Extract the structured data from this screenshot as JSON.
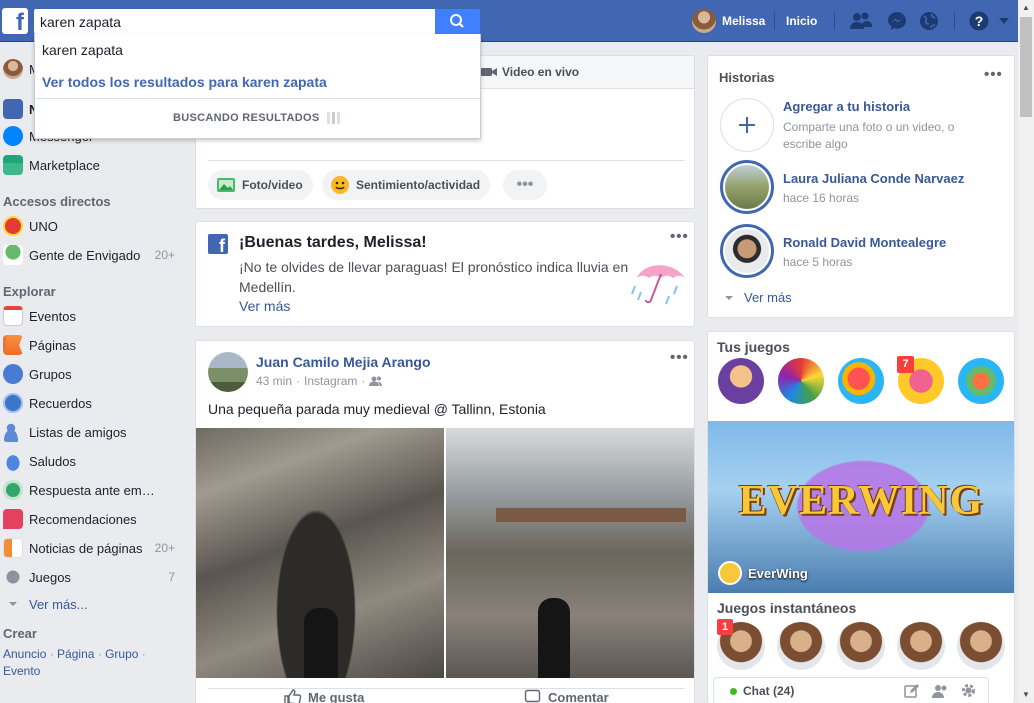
{
  "topbar": {
    "logo": "f",
    "search_value": "karen zapata",
    "user_name": "Melissa",
    "home_label": "Inicio",
    "icons": [
      "friend-requests-icon",
      "messenger-icon",
      "notifications-globe-icon",
      "help-icon",
      "caret-down-icon"
    ]
  },
  "dropdown": {
    "suggestion": "karen zapata",
    "see_all": "Ver todos los resultados para karen zapata",
    "status": "BUSCANDO RESULTADOS"
  },
  "left_nav": {
    "profile_initial": "M",
    "news_initial": "N",
    "messenger_partial": "Messenger",
    "marketplace": "Marketplace",
    "shortcuts_header": "Accesos directos",
    "shortcuts": [
      {
        "label": "UNO",
        "count": ""
      },
      {
        "label": "Gente de Envigado",
        "count": "20+"
      }
    ],
    "explore_header": "Explorar",
    "explore": [
      {
        "label": "Eventos",
        "count": ""
      },
      {
        "label": "Páginas",
        "count": ""
      },
      {
        "label": "Grupos",
        "count": ""
      },
      {
        "label": "Recuerdos",
        "count": ""
      },
      {
        "label": "Listas de amigos",
        "count": ""
      },
      {
        "label": "Saludos",
        "count": ""
      },
      {
        "label": "Respuesta ante em…",
        "count": ""
      },
      {
        "label": "Recomendaciones",
        "count": ""
      },
      {
        "label": "Noticias de páginas",
        "count": "20+"
      },
      {
        "label": "Juegos",
        "count": "7"
      }
    ],
    "see_more": "Ver más...",
    "create_header": "Crear",
    "create_links": [
      "Anuncio",
      "Página",
      "Grupo",
      "Evento"
    ]
  },
  "composer": {
    "live_video": "Video en vivo",
    "photo_video": "Foto/video",
    "feeling": "Sentimiento/actividad"
  },
  "weather": {
    "title": "¡Buenas tardes, Melissa!",
    "body": "¡No te olvides de llevar paraguas! El pronóstico indica lluvia en Medellín.",
    "more": "Ver más"
  },
  "post": {
    "author": "Juan Camilo Mejia Arango",
    "time": "43 min",
    "source": "Instagram",
    "text": "Una pequeña parada muy medieval @ Tallinn, Estonia",
    "like": "Me gusta",
    "comment": "Comentar"
  },
  "stories": {
    "header": "Historias",
    "add_title": "Agregar a tu historia",
    "add_sub": "Comparte una foto o un video, o escribe algo",
    "items": [
      {
        "name": "Laura Juliana Conde Narvaez",
        "time": "hace 16 horas"
      },
      {
        "name": "Ronald David Montealegre",
        "time": "hace 5 horas"
      }
    ],
    "see_more": "Ver más"
  },
  "games": {
    "header": "Tus juegos",
    "badge": "7",
    "banner_title": "EVERWING",
    "banner_name": "EverWing",
    "instant_header": "Juegos instantáneos",
    "instant_badge": "1"
  },
  "chat": {
    "label": "Chat (24)"
  },
  "colors": {
    "brand": "#4267b2",
    "link": "#385898",
    "online": "#42b72a"
  }
}
